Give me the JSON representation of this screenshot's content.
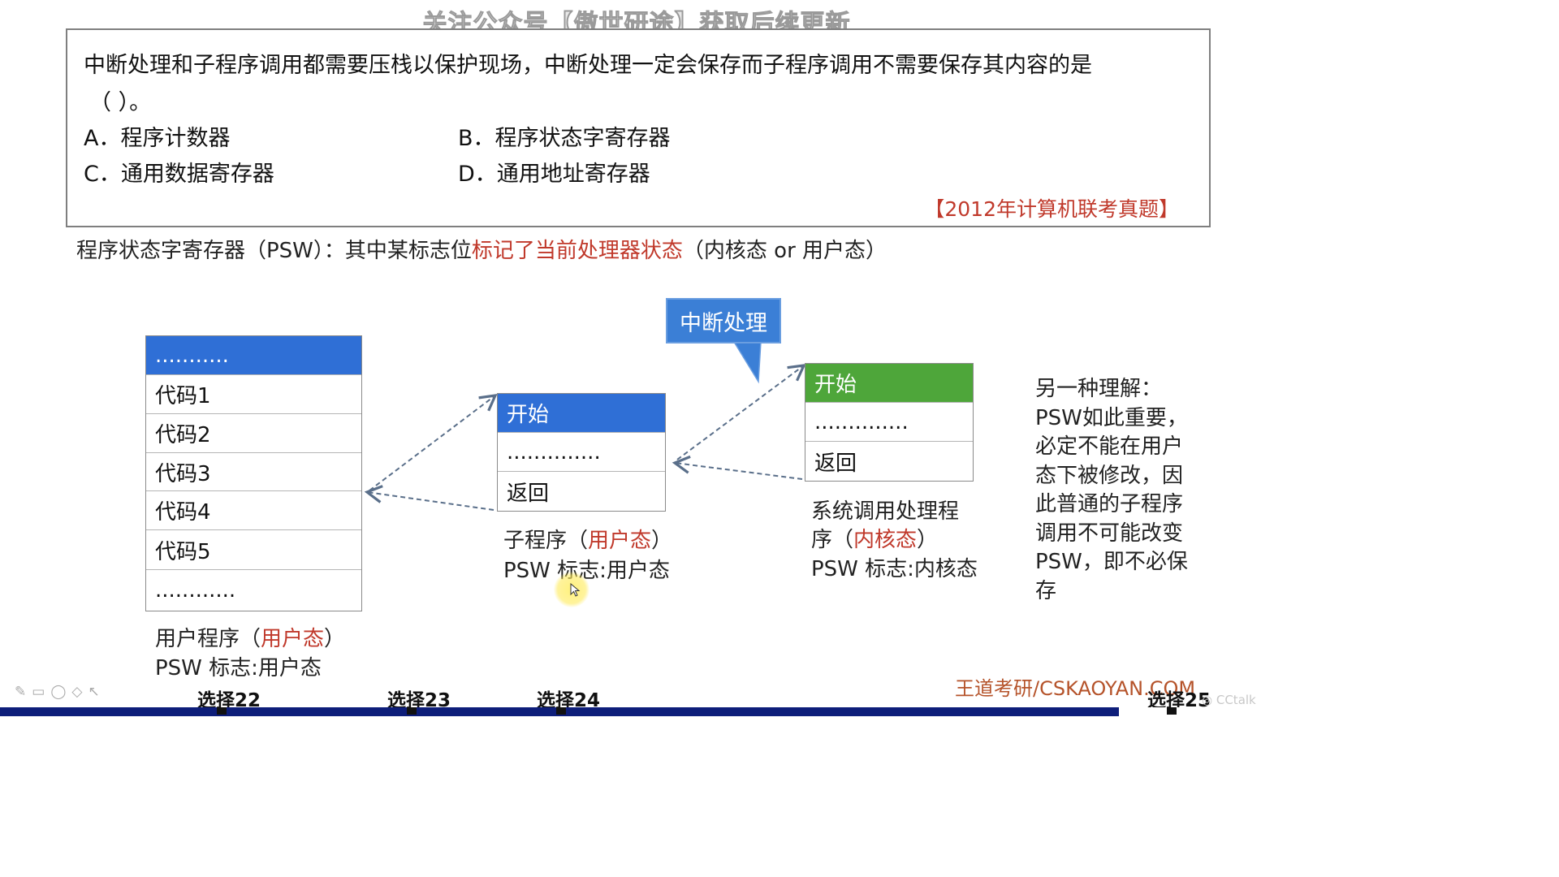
{
  "watermark": "关注公众号【傲世研途】获取后续更新",
  "question": {
    "line1": "中断处理和子程序调用都需要压栈以保护现场，中断处理一定会保存而子程序调用不需要保存其内容的是",
    "line2": "（    ）。",
    "options": [
      {
        "letter": "A．",
        "text": "程序计数器"
      },
      {
        "letter": "B．",
        "text": "程序状态字寄存器"
      },
      {
        "letter": "C．",
        "text": "通用数据寄存器"
      },
      {
        "letter": "D．",
        "text": "通用地址寄存器"
      }
    ],
    "source": "【2012年计算机联考真题】"
  },
  "explanation": {
    "prefix": "程序状态字寄存器（PSW）：其中某标志位",
    "highlight": "标记了当前处理器状态",
    "suffix": "（内核态 or 用户态）"
  },
  "user_program": {
    "header": "...........",
    "rows": [
      "代码1",
      "代码2",
      "代码3",
      "代码4",
      "代码5",
      "............"
    ],
    "caption_prefix": "用户程序（",
    "caption_mode": "用户态",
    "caption_suffix": "）",
    "psw": "PSW 标志:用户态"
  },
  "subroutine": {
    "header": "开始",
    "rows": [
      "..............",
      "返回"
    ],
    "caption_prefix": "子程序（",
    "caption_mode": "用户态",
    "caption_suffix": "）",
    "psw": "PSW 标志:用户态"
  },
  "interrupt_callout": "中断处理",
  "syscall": {
    "header": "开始",
    "rows": [
      "..............",
      "返回"
    ],
    "caption_line1": "系统调用处理程",
    "caption_prefix": "序（",
    "caption_mode": "内核态",
    "caption_suffix": "）",
    "psw": "PSW 标志:内核态"
  },
  "side_note": [
    "另一种理解：",
    "PSW如此重要，",
    "必定不能在用户",
    "态下被修改，因",
    "此普通的子程序",
    "调用不可能改变",
    "PSW，即不必保",
    "存"
  ],
  "brand": "王道考研/CSKAOYAN.COM",
  "chapters": [
    "选择22",
    "选择23",
    "选择24",
    "选择25"
  ],
  "cctalk": "CCtalk",
  "colors": {
    "accent_blue": "#2f6fd6",
    "accent_green": "#4ea63a",
    "highlight_red": "#c0392b",
    "nav_bar": "#0e1e7a"
  }
}
